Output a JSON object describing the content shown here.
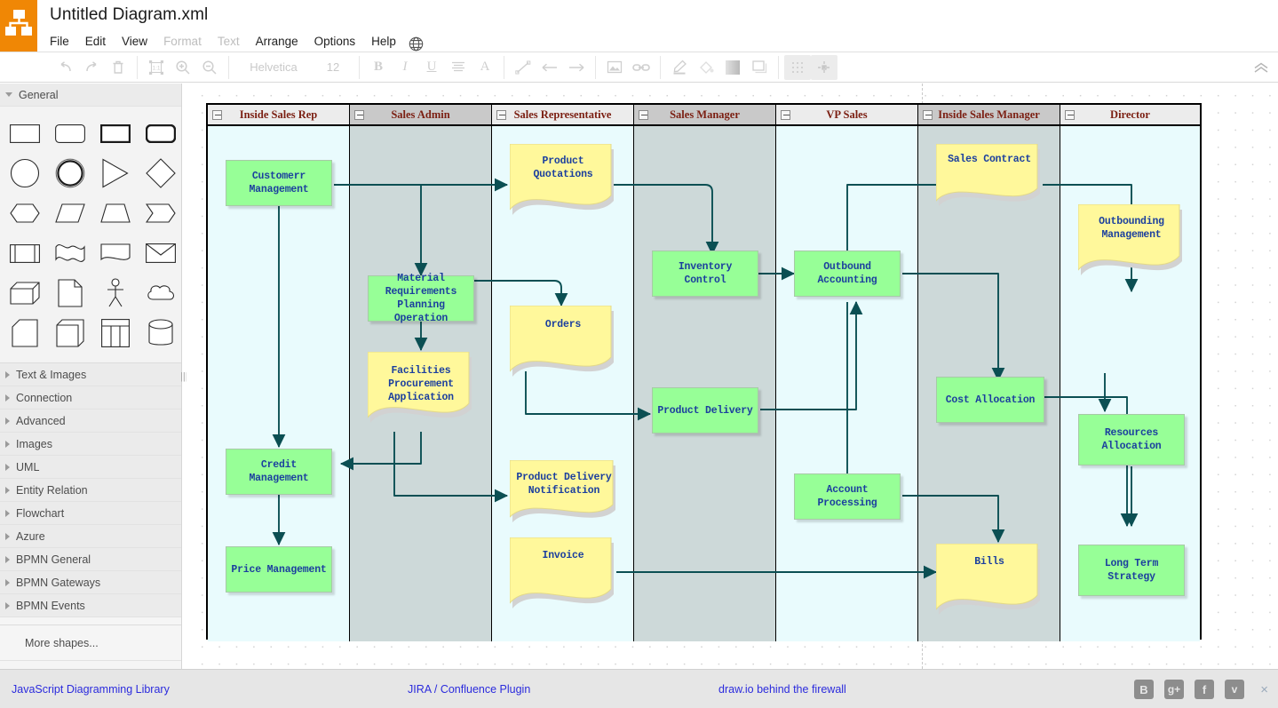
{
  "app": {
    "title": "Untitled Diagram.xml",
    "logo_icon": "drawio-logo-icon"
  },
  "menubar": {
    "items": [
      {
        "label": "File",
        "enabled": true
      },
      {
        "label": "Edit",
        "enabled": true
      },
      {
        "label": "View",
        "enabled": true
      },
      {
        "label": "Format",
        "enabled": false
      },
      {
        "label": "Text",
        "enabled": false
      },
      {
        "label": "Arrange",
        "enabled": true
      },
      {
        "label": "Options",
        "enabled": true
      },
      {
        "label": "Help",
        "enabled": true
      }
    ],
    "language_icon": "globe-icon"
  },
  "toolbar": {
    "undo_icon": "undo-icon",
    "redo_icon": "redo-icon",
    "delete_icon": "trash-icon",
    "actual_size_icon": "zoom-actual-size-icon",
    "zoom_in_icon": "zoom-in-icon",
    "zoom_out_icon": "zoom-out-icon",
    "font_family": "Helvetica",
    "font_size": "12",
    "bold": "B",
    "italic": "I",
    "underline": "U",
    "align_icon": "align-left-icon",
    "font_color_icon": "font-color-icon",
    "line_icon": "line-icon",
    "arrow_left_icon": "arrow-left-icon",
    "arrow_right_icon": "arrow-right-icon",
    "image_icon": "insert-image-icon",
    "link_icon": "insert-link-icon",
    "line_color_icon": "line-color-icon",
    "fill_color_icon": "fill-color-icon",
    "shadow_icon": "shadow-icon",
    "rounded_icon": "rounded-shape-icon",
    "grid_icon": "grid-icon",
    "waypoints_icon": "waypoints-icon",
    "collapse_icon": "collapse-toolbar-icon"
  },
  "sidebar": {
    "sections": [
      {
        "label": "General",
        "open": true
      },
      {
        "label": "Text & Images",
        "open": false
      },
      {
        "label": "Connection",
        "open": false
      },
      {
        "label": "Advanced",
        "open": false
      },
      {
        "label": "Images",
        "open": false
      },
      {
        "label": "UML",
        "open": false
      },
      {
        "label": "Entity Relation",
        "open": false
      },
      {
        "label": "Flowchart",
        "open": false
      },
      {
        "label": "Azure",
        "open": false
      },
      {
        "label": "BPMN General",
        "open": false
      },
      {
        "label": "BPMN Gateways",
        "open": false
      },
      {
        "label": "BPMN Events",
        "open": false
      }
    ],
    "more_shapes": "More shapes...",
    "shapes": [
      "rectangle-shape",
      "rounded-rectangle-shape",
      "bold-rectangle-shape",
      "bold-rounded-rectangle-shape",
      "ellipse-shape",
      "double-ellipse-shape",
      "triangle-shape",
      "rhombus-shape",
      "hexagon-shape",
      "parallelogram-shape",
      "trapezoid-shape",
      "step-shape",
      "process-shape",
      "tape-shape",
      "document-shape",
      "envelope-shape",
      "cube-shape",
      "note-shape",
      "actor-shape",
      "cloud-shape",
      "card-shape",
      "internal-storage-shape",
      "table-shape",
      "cylinder-shape"
    ]
  },
  "diagram": {
    "lanes": [
      {
        "label": "Inside Sales Rep",
        "shade": "light"
      },
      {
        "label": "Sales Admin",
        "shade": "dark"
      },
      {
        "label": "Sales Representative",
        "shade": "light"
      },
      {
        "label": "Sales Manager",
        "shade": "dark"
      },
      {
        "label": "VP Sales",
        "shade": "light"
      },
      {
        "label": "Inside Sales Manager",
        "shade": "dark"
      },
      {
        "label": "Director",
        "shade": "light"
      }
    ],
    "nodes": [
      {
        "id": "customerr-management",
        "label": "Customerr\nManagement",
        "type": "process",
        "lane": "Inside Sales Rep"
      },
      {
        "id": "credit-management",
        "label": "Credit\nManagement",
        "type": "process",
        "lane": "Inside Sales Rep"
      },
      {
        "id": "price-management",
        "label": "Price Management",
        "type": "process",
        "lane": "Inside Sales Rep"
      },
      {
        "id": "material-requirements-planning-operation",
        "label": "Material\nRequirements\nPlanning\nOperation",
        "type": "process",
        "lane": "Sales Admin"
      },
      {
        "id": "facilities-procurement-application",
        "label": "Facilities\nProcurement\nApplication",
        "type": "document",
        "lane": "Sales Admin"
      },
      {
        "id": "product-quotations",
        "label": "Product\nQuotations",
        "type": "document",
        "lane": "Sales Representative"
      },
      {
        "id": "orders",
        "label": "Orders",
        "type": "document",
        "lane": "Sales Representative"
      },
      {
        "id": "product-delivery-notification",
        "label": "Product Delivery\nNotification",
        "type": "document",
        "lane": "Sales Representative"
      },
      {
        "id": "invoice",
        "label": "Invoice",
        "type": "document",
        "lane": "Sales Representative"
      },
      {
        "id": "inventory-control",
        "label": "Inventory\nControl",
        "type": "process",
        "lane": "Sales Manager"
      },
      {
        "id": "product-delivery",
        "label": "Product Delivery",
        "type": "process",
        "lane": "Sales Manager"
      },
      {
        "id": "outbound-accounting",
        "label": "Outbound\nAccounting",
        "type": "process",
        "lane": "VP Sales"
      },
      {
        "id": "account-processing",
        "label": "Account\nProcessing",
        "type": "process",
        "lane": "VP Sales"
      },
      {
        "id": "sales-contract",
        "label": "Sales Contract",
        "type": "document",
        "lane": "Inside Sales Manager"
      },
      {
        "id": "cost-allocation",
        "label": "Cost Allocation",
        "type": "process",
        "lane": "Inside Sales Manager"
      },
      {
        "id": "bills",
        "label": "Bills",
        "type": "document",
        "lane": "Inside Sales Manager"
      },
      {
        "id": "outbounding-management",
        "label": "Outbounding\nManagement",
        "type": "document",
        "lane": "Director"
      },
      {
        "id": "resources-allocation",
        "label": "Resources\nAllocation",
        "type": "process",
        "lane": "Director"
      },
      {
        "id": "long-term-strategy",
        "label": "Long Term\nStrategy",
        "type": "process",
        "lane": "Director"
      }
    ],
    "edges": [
      {
        "from": "customerr-management",
        "to": "product-quotations"
      },
      {
        "from": "customerr-management",
        "to": "material-requirements-planning-operation"
      },
      {
        "from": "customerr-management",
        "to": "credit-management"
      },
      {
        "from": "credit-management",
        "to": "price-management"
      },
      {
        "from": "material-requirements-planning-operation",
        "to": "orders"
      },
      {
        "from": "material-requirements-planning-operation",
        "to": "facilities-procurement-application"
      },
      {
        "from": "facilities-procurement-application",
        "to": "credit-management"
      },
      {
        "from": "facilities-procurement-application",
        "to": "product-delivery-notification"
      },
      {
        "from": "product-quotations",
        "to": "inventory-control"
      },
      {
        "from": "orders",
        "to": "product-delivery"
      },
      {
        "from": "inventory-control",
        "to": "outbound-accounting"
      },
      {
        "from": "product-delivery",
        "to": "outbound-accounting"
      },
      {
        "from": "outbound-accounting",
        "to": "sales-contract"
      },
      {
        "from": "outbound-accounting",
        "to": "cost-allocation"
      },
      {
        "from": "outbound-accounting",
        "to": "account-processing"
      },
      {
        "from": "account-processing",
        "to": "bills"
      },
      {
        "from": "invoice",
        "to": "bills"
      },
      {
        "from": "sales-contract",
        "to": "outbounding-management"
      },
      {
        "from": "outbounding-management",
        "to": "resources-allocation"
      },
      {
        "from": "cost-allocation",
        "to": "long-term-strategy"
      },
      {
        "from": "resources-allocation",
        "to": "long-term-strategy"
      }
    ],
    "colors": {
      "process_fill": "#97ff97",
      "document_fill": "#fff89b",
      "edge": "#0b4f53",
      "label_text": "#1b3f9e",
      "lane_label_text": "#7b1f12",
      "lane_light": "#e9fbfd",
      "lane_dark": "#cdd9d9"
    }
  },
  "footer": {
    "links": [
      {
        "label": "JavaScript Diagramming Library"
      },
      {
        "label": "JIRA / Confluence Plugin"
      },
      {
        "label": "draw.io behind the firewall"
      }
    ],
    "social": [
      {
        "name": "blogger-icon",
        "glyph": "B"
      },
      {
        "name": "google-plus-icon",
        "glyph": "g+"
      },
      {
        "name": "facebook-icon",
        "glyph": "f"
      },
      {
        "name": "twitter-icon",
        "glyph": "ᴠ"
      }
    ],
    "close": "×"
  }
}
